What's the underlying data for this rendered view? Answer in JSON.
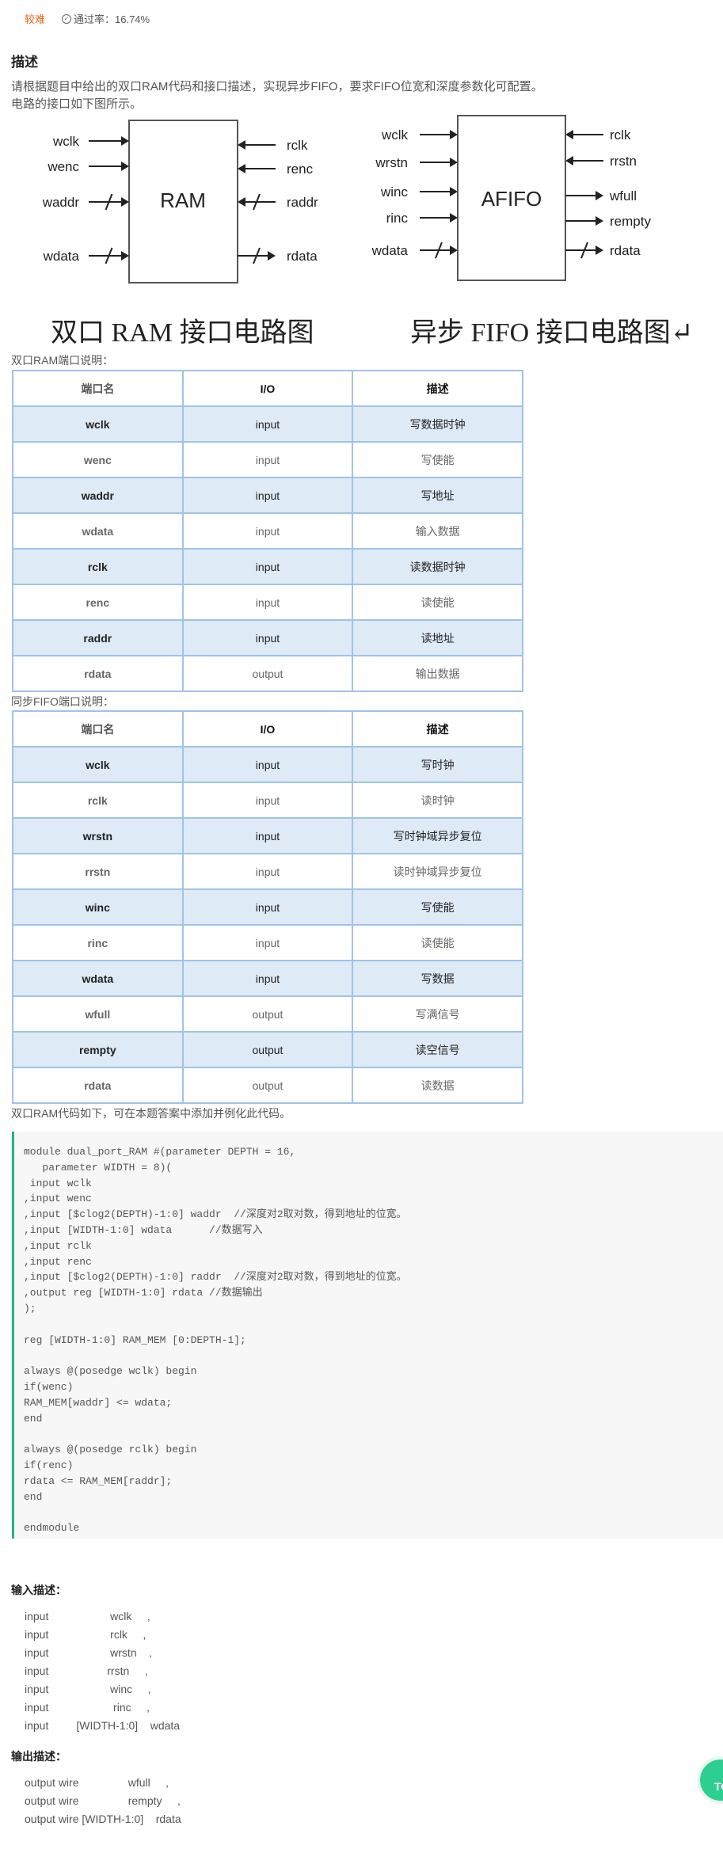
{
  "header": {
    "difficulty": "较难",
    "pass_rate": "通过率：16.74%"
  },
  "description": {
    "title": "描述",
    "line1": "请根据题目中给出的双口RAM代码和接口描述，实现异步FIFO，要求FIFO位宽和深度参数化可配置。",
    "line2": "电路的接口如下图所示。"
  },
  "diagram": {
    "ram": {
      "name": "RAM",
      "left": [
        "wclk",
        "wenc",
        "waddr",
        "wdata"
      ],
      "right": [
        "rclk",
        "renc",
        "raddr",
        "rdata"
      ],
      "caption": "双口 RAM 接口电路图"
    },
    "fifo": {
      "name": "AFIFO",
      "left": [
        "wclk",
        "wrstn",
        "winc",
        "rinc",
        "wdata"
      ],
      "right": [
        "rclk",
        "rrstn",
        "wfull",
        "rempty",
        "rdata"
      ],
      "caption": "异步 FIFO 接口电路图↵"
    }
  },
  "ram_table": {
    "label": "双口RAM端口说明：",
    "headers": [
      "端口名",
      "I/O",
      "描述"
    ],
    "rows": [
      [
        "wclk",
        "input",
        "写数据时钟"
      ],
      [
        "wenc",
        "input",
        "写使能"
      ],
      [
        "waddr",
        "input",
        "写地址"
      ],
      [
        "wdata",
        "input",
        "输入数据"
      ],
      [
        "rclk",
        "input",
        "读数据时钟"
      ],
      [
        "renc",
        "input",
        "读使能"
      ],
      [
        "raddr",
        "input",
        "读地址"
      ],
      [
        "rdata",
        "output",
        "输出数据"
      ]
    ]
  },
  "fifo_table": {
    "label": "同步FIFO端口说明：",
    "headers": [
      "端口名",
      "I/O",
      "描述"
    ],
    "rows": [
      [
        "wclk",
        "input",
        "写时钟"
      ],
      [
        "rclk",
        "input",
        "读时钟"
      ],
      [
        "wrstn",
        "input",
        "写时钟域异步复位"
      ],
      [
        "rrstn",
        "input",
        "读时钟域异步复位"
      ],
      [
        "winc",
        "input",
        "写使能"
      ],
      [
        "rinc",
        "input",
        "读使能"
      ],
      [
        "wdata",
        "input",
        "写数据"
      ],
      [
        "wfull",
        "output",
        "写满信号"
      ],
      [
        "rempty",
        "output",
        "读空信号"
      ],
      [
        "rdata",
        "output",
        "读数据"
      ]
    ]
  },
  "code_label": "双口RAM代码如下，可在本题答案中添加并例化此代码。",
  "code": "module dual_port_RAM #(parameter DEPTH = 16,\n   parameter WIDTH = 8)(\n input wclk\n,input wenc\n,input [$clog2(DEPTH)-1:0] waddr  //深度对2取对数，得到地址的位宽。\n,input [WIDTH-1:0] wdata      //数据写入\n,input rclk\n,input renc\n,input [$clog2(DEPTH)-1:0] raddr  //深度对2取对数，得到地址的位宽。\n,output reg [WIDTH-1:0] rdata //数据输出\n);\n\nreg [WIDTH-1:0] RAM_MEM [0:DEPTH-1];\n\nalways @(posedge wclk) begin\nif(wenc)\nRAM_MEM[waddr] <= wdata;\nend\n\nalways @(posedge rclk) begin\nif(renc)\nrdata <= RAM_MEM[raddr];\nend\n\nendmodule",
  "input_desc": {
    "title": "输入描述：",
    "lines": [
      "input                    wclk     ,",
      "input                    rclk     ,",
      "input                    wrstn    ,",
      "input                   rrstn     ,",
      "input                    winc     ,",
      "input                     rinc     ,",
      "input         [WIDTH-1:0]    wdata"
    ]
  },
  "output_desc": {
    "title": "输出描述：",
    "lines": [
      "output wire                wfull     ,",
      "output wire                rempty     ,",
      "output wire [WIDTH-1:0]    rdata"
    ]
  },
  "to_top": "TO"
}
